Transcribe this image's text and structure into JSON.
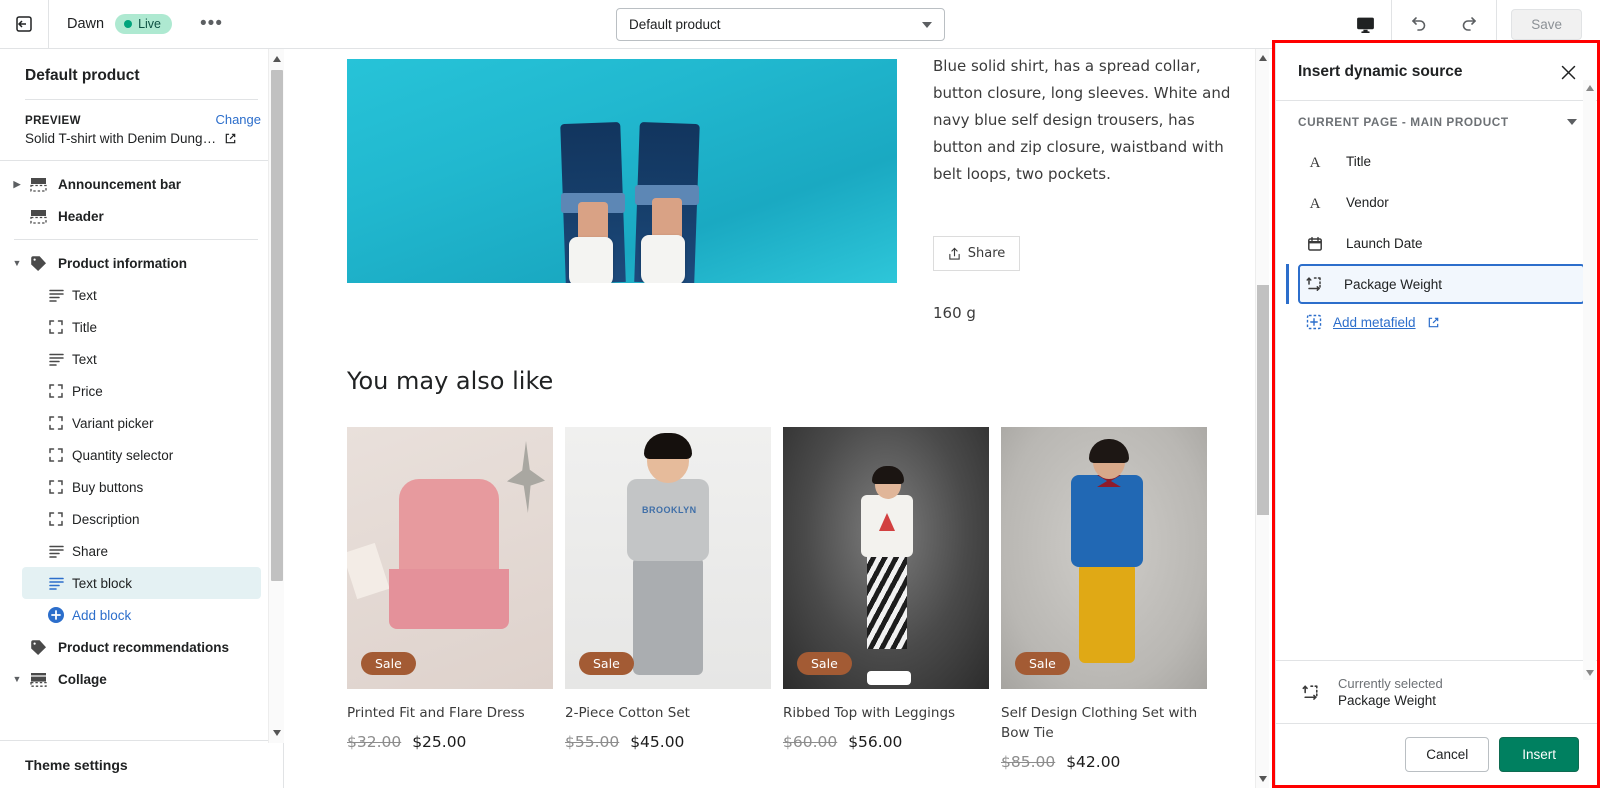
{
  "topbar": {
    "exit_icon": "exit-icon",
    "theme_name": "Dawn",
    "live_label": "Live",
    "more_label": "•••",
    "page_selector_value": "Default product",
    "device_icon": "desktop-icon",
    "undo_icon": "undo-icon",
    "redo_icon": "redo-icon",
    "save_label": "Save"
  },
  "sidebar": {
    "title": "Default product",
    "preview_label": "PREVIEW",
    "change_label": "Change",
    "preview_value": "Solid T-shirt with Denim Dung…",
    "external_icon": "external-link-icon",
    "items": [
      {
        "label": "Announcement bar",
        "type": "section",
        "icon": "section-icon",
        "disclosure": "collapsed"
      },
      {
        "label": "Header",
        "type": "section",
        "icon": "section-icon",
        "disclosure": "none"
      },
      {
        "label": "Product information",
        "type": "section",
        "icon": "tag-icon",
        "disclosure": "expanded"
      },
      {
        "label": "Text",
        "type": "block",
        "icon": "text-lines-icon"
      },
      {
        "label": "Title",
        "type": "block",
        "icon": "block-brackets-icon"
      },
      {
        "label": "Text",
        "type": "block",
        "icon": "text-lines-icon"
      },
      {
        "label": "Price",
        "type": "block",
        "icon": "block-brackets-icon"
      },
      {
        "label": "Variant picker",
        "type": "block",
        "icon": "block-brackets-icon"
      },
      {
        "label": "Quantity selector",
        "type": "block",
        "icon": "block-brackets-icon"
      },
      {
        "label": "Buy buttons",
        "type": "block",
        "icon": "block-brackets-icon"
      },
      {
        "label": "Description",
        "type": "block",
        "icon": "block-brackets-icon"
      },
      {
        "label": "Share",
        "type": "block",
        "icon": "text-lines-icon"
      },
      {
        "label": "Text block",
        "type": "block-selected",
        "icon": "text-lines-icon"
      },
      {
        "label": "Add block",
        "type": "add",
        "icon": "plus-circle-icon"
      },
      {
        "label": "Product recommendations",
        "type": "section",
        "icon": "tag-icon",
        "disclosure": "none"
      },
      {
        "label": "Collage",
        "type": "section",
        "icon": "collage-icon",
        "disclosure": "expanded"
      }
    ],
    "footer_label": "Theme settings"
  },
  "preview": {
    "description": "Blue solid shirt, has a spread collar, button closure, long sleeves.\nWhite and navy blue self design trousers, has button and zip closure, waistband with belt loops, two pockets.",
    "share_label": "Share",
    "share_icon": "share-icon",
    "weight_value": "160 g",
    "recommendations_title": "You may also like",
    "sale_badge": "Sale",
    "products": [
      {
        "name": "Printed Fit and Flare Dress",
        "price_old": "$32.00",
        "price_new": "$25.00",
        "badge": "Sale"
      },
      {
        "name": "2-Piece Cotton Set",
        "price_old": "$55.00",
        "price_new": "$45.00",
        "badge": "Sale"
      },
      {
        "name": "Ribbed Top with Leggings",
        "price_old": "$60.00",
        "price_new": "$56.00",
        "badge": "Sale"
      },
      {
        "name": "Self Design Clothing Set with Bow Tie",
        "price_old": "$85.00",
        "price_new": "$42.00",
        "badge": "Sale"
      }
    ]
  },
  "dialog": {
    "title": "Insert dynamic source",
    "close_icon": "close-icon",
    "group_label": "CURRENT PAGE - MAIN PRODUCT",
    "group_caret": "chevron-down-icon",
    "sources": [
      {
        "label": "Title",
        "icon": "text-a-icon"
      },
      {
        "label": "Vendor",
        "icon": "text-a-icon"
      },
      {
        "label": "Launch Date",
        "icon": "calendar-icon"
      },
      {
        "label": "Package Weight",
        "icon": "weight-icon",
        "selected": true
      }
    ],
    "add_metafield_label": "Add metafield",
    "add_metafield_icon": "plus-square-icon",
    "add_metafield_external_icon": "external-link-icon",
    "currently_selected_label": "Currently selected",
    "currently_selected_value": "Package Weight",
    "currently_selected_icon": "weight-icon",
    "cancel_label": "Cancel",
    "insert_label": "Insert"
  },
  "colors": {
    "accent_blue": "#2c6ecb",
    "insert_green": "#008060",
    "live_badge_bg": "#aee9d1",
    "highlight_red": "#ff0000",
    "sale_badge": "#a35b34"
  }
}
